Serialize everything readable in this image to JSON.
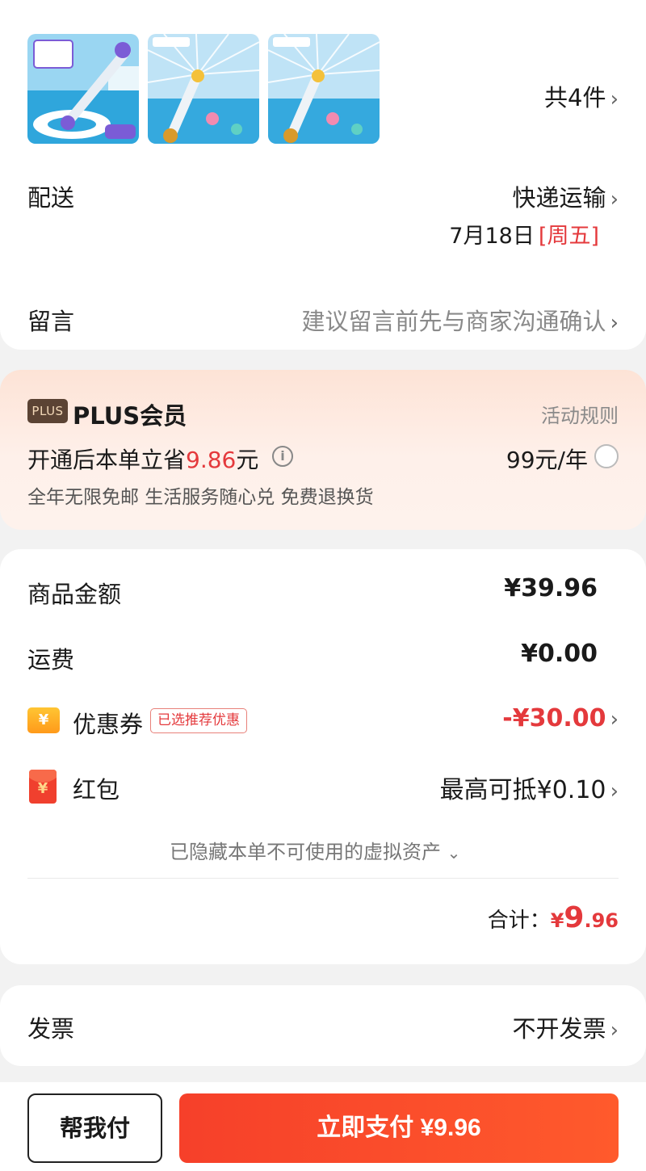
{
  "order": {
    "count_label": "共4件"
  },
  "delivery": {
    "label": "配送",
    "method": "快递运输",
    "date": "7月18日",
    "weekday": "[周五]"
  },
  "message": {
    "label": "留言",
    "placeholder": "建议留言前先与商家沟通确认"
  },
  "plus": {
    "badge": "PLUS",
    "title": "PLUS会员",
    "rules_link": "活动规则",
    "save_prefix": "开通后本单立省",
    "save_amount": "9.86",
    "save_suffix": "元",
    "price": "99元/年",
    "benefits": "全年无限免邮 生活服务随心兑 免费退换货"
  },
  "summary": {
    "goods_label": "商品金额",
    "goods_value": "¥39.96",
    "shipping_label": "运费",
    "shipping_value": "¥0.00",
    "coupon_icon": "¥",
    "coupon_label": "优惠券",
    "coupon_tag": "已选推荐优惠",
    "coupon_value": "-¥30.00",
    "redpacket_icon": "¥",
    "redpacket_label": "红包",
    "redpacket_value": "最高可抵¥0.10",
    "hidden_assets": "已隐藏本单不可使用的虚拟资产",
    "total_label": "合计：",
    "total_currency": "¥",
    "total_int": "9",
    "total_dec": ".96"
  },
  "invoice": {
    "label": "发票",
    "value": "不开发票"
  },
  "bottom": {
    "help_pay": "帮我付",
    "pay_now": "立即支付 ¥9.96"
  },
  "colors": {
    "accent_red": "#e4393c",
    "pay_button": "#f6402a",
    "plus_badge": "#5b4334"
  }
}
